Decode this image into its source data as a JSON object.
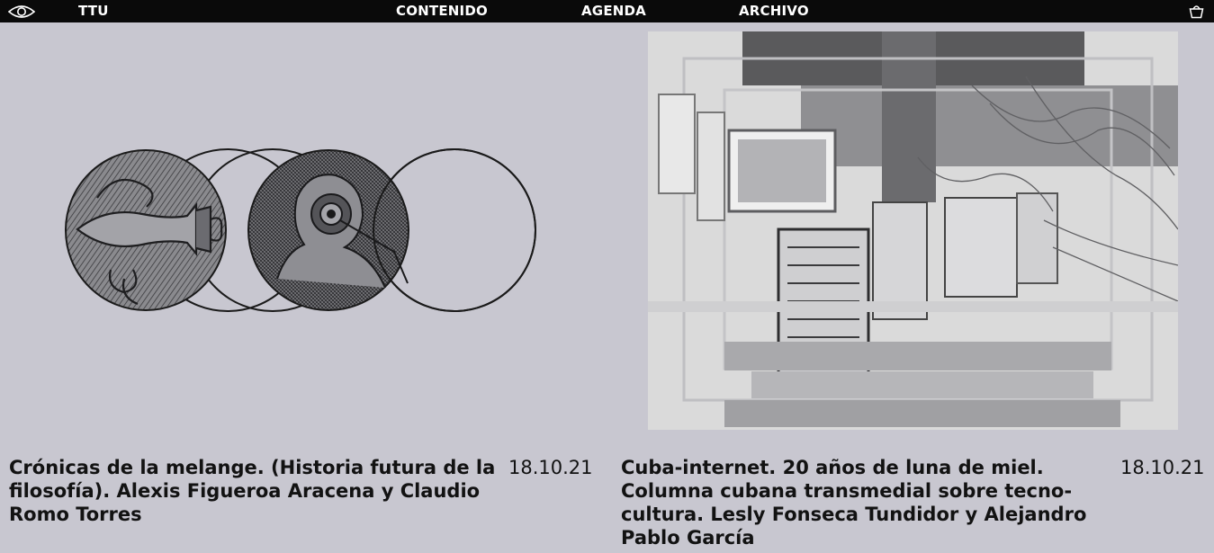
{
  "header": {
    "brand": "TTU",
    "nav": [
      {
        "label": "CONTENIDO"
      },
      {
        "label": "AGENDA"
      },
      {
        "label": "ARCHIVO"
      }
    ],
    "icons": {
      "left": "eye-icon",
      "right": "shopping-basket-icon"
    }
  },
  "articles": [
    {
      "title": "Crónicas de la melange. (Historia futura de la filosofía). Alexis Figueroa Aracena y Claudio Romo Torres",
      "date": "18.10.21",
      "image": "engraved-circles-illustration"
    },
    {
      "title": "Cuba-internet. 20 años de luna de miel. Columna cubana transmedial sobre tecno-cultura. Lesly Fonseca Tundidor y Alejandro Pablo García",
      "date": "18.10.21",
      "image": "glitched-computer-hardware-photo"
    }
  ],
  "colors": {
    "background": "#c8c7d0",
    "topbar": "#0a0a0a",
    "text": "#121212"
  }
}
